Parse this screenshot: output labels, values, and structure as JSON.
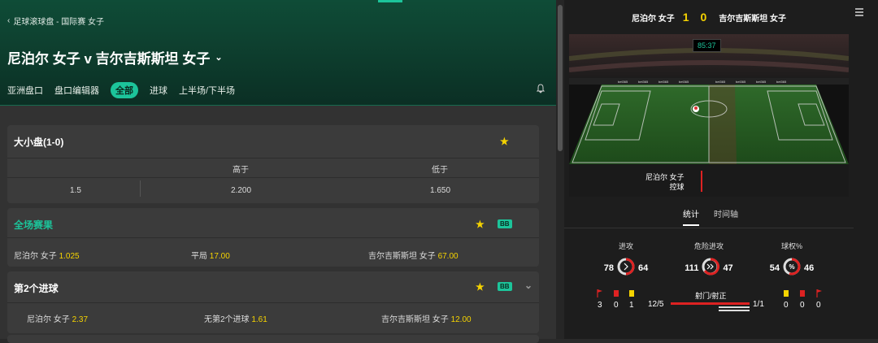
{
  "breadcrumb": "足球滚球盘 - 国际赛 女子",
  "match_title": "尼泊尔 女子 v 吉尔吉斯斯坦 女子",
  "tabs": [
    "亚洲盘口",
    "盘口编辑器",
    "全部",
    "进球",
    "上半场/下半场"
  ],
  "active_tab": "全部",
  "markets": {
    "over_under": {
      "title": "大小盘(1-0)",
      "col_over": "高于",
      "col_under": "低于",
      "line": "1.5",
      "over_odds": "2.200",
      "under_odds": "1.650"
    },
    "full_time": {
      "title": "全场赛果",
      "badge": "BB",
      "home_label": "尼泊尔 女子",
      "home_odds": "1.025",
      "draw_label": "平局",
      "draw_odds": "17.00",
      "away_label": "吉尔吉斯斯坦 女子",
      "away_odds": "67.00"
    },
    "second_goal": {
      "title": "第2个进球",
      "badge": "BB",
      "home_label": "尼泊尔 女子",
      "home_odds": "2.37",
      "none_label": "无第2个进球",
      "none_odds": "1.61",
      "away_label": "吉尔吉斯斯坦 女子",
      "away_odds": "12.00"
    }
  },
  "scoreboard": {
    "home": "尼泊尔 女子",
    "score": "1 0",
    "away": "吉尔吉斯斯坦 女子",
    "clock": "85:37",
    "possession_team": "尼泊尔 女子",
    "possession_label": "控球"
  },
  "stat_tabs": [
    "统计",
    "时间轴"
  ],
  "stats": {
    "attacks": {
      "title": "进攻",
      "home": "78",
      "away": "64"
    },
    "dangerous": {
      "title": "危险进攻",
      "home": "111",
      "away": "47"
    },
    "possession": {
      "title": "球权%",
      "home": "54",
      "away": "46"
    }
  },
  "bottom": {
    "home_corners": "3",
    "home_red": "0",
    "home_yellow": "1",
    "shots_label": "射门/射正",
    "home_shots": "12/5",
    "away_shots": "1/1",
    "away_yellow": "0",
    "away_red": "0",
    "away_corners": "0"
  },
  "colors": {
    "accent": "#1cc49a",
    "odds": "#f5d300",
    "header_green": "#0f4c37",
    "red": "#dd2222"
  }
}
